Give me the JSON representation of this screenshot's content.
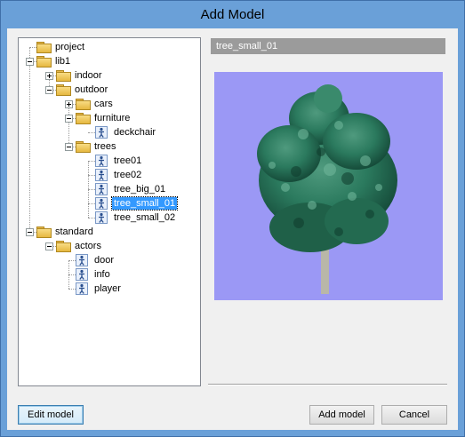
{
  "window": {
    "title": "Add Model"
  },
  "tree": {
    "nodes": [
      {
        "label": "project",
        "kind": "folder",
        "level": 0,
        "expander": "none"
      },
      {
        "label": "lib1",
        "kind": "folder",
        "level": 0,
        "expander": "minus"
      },
      {
        "label": "indoor",
        "kind": "folder",
        "level": 1,
        "expander": "plus"
      },
      {
        "label": "outdoor",
        "kind": "folder",
        "level": 1,
        "expander": "minus"
      },
      {
        "label": "cars",
        "kind": "folder",
        "level": 2,
        "expander": "plus"
      },
      {
        "label": "furniture",
        "kind": "folder",
        "level": 2,
        "expander": "minus"
      },
      {
        "label": "deckchair",
        "kind": "model",
        "level": 3,
        "expander": "none"
      },
      {
        "label": "trees",
        "kind": "folder",
        "level": 2,
        "expander": "minus"
      },
      {
        "label": "tree01",
        "kind": "model",
        "level": 3,
        "expander": "none"
      },
      {
        "label": "tree02",
        "kind": "model",
        "level": 3,
        "expander": "none"
      },
      {
        "label": "tree_big_01",
        "kind": "model",
        "level": 3,
        "expander": "none"
      },
      {
        "label": "tree_small_01",
        "kind": "model",
        "level": 3,
        "expander": "none",
        "selected": true
      },
      {
        "label": "tree_small_02",
        "kind": "model",
        "level": 3,
        "expander": "none"
      },
      {
        "label": "standard",
        "kind": "folder",
        "level": 0,
        "expander": "minus"
      },
      {
        "label": "actors",
        "kind": "folder",
        "level": 1,
        "expander": "minus"
      },
      {
        "label": "door",
        "kind": "model",
        "level": 2,
        "expander": "none"
      },
      {
        "label": "info",
        "kind": "model",
        "level": 2,
        "expander": "none"
      },
      {
        "label": "player",
        "kind": "model",
        "level": 2,
        "expander": "none"
      }
    ]
  },
  "preview": {
    "title": "tree_small_01",
    "background": "#9b98f5",
    "image": "tree-preview"
  },
  "buttons": {
    "edit_model": "Edit model",
    "add_model": "Add model",
    "cancel": "Cancel"
  },
  "colors": {
    "selection": "#3399ff",
    "titlebar": "#6aa0d8",
    "preview_header": "#9b9b9b"
  }
}
